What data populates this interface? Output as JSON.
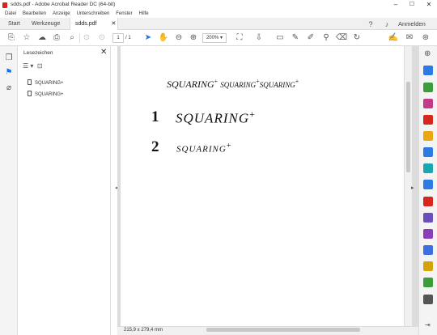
{
  "window": {
    "title": "sdds.pdf - Adobe Acrobat Reader DC (64-bit)",
    "controls": [
      "–",
      "☐",
      "✕"
    ]
  },
  "menu": [
    "Datei",
    "Bearbeiten",
    "Anzeige",
    "Unterschreiben",
    "Fenster",
    "Hilfe"
  ],
  "tabs": {
    "start": "Start",
    "tools": "Werkzeuge",
    "doc": "sdds.pdf",
    "signin": "Anmelden"
  },
  "toolbar": {
    "page_current": "1",
    "page_total": "/ 1",
    "zoom": "200%"
  },
  "bookmarks": {
    "header": "Lesezeichen",
    "items": [
      "SQUARING+",
      "SQUARING+"
    ]
  },
  "document": {
    "running": {
      "t1": "SQUARING",
      "t2": "SQUARING",
      "t3": "SQUARING",
      "sup": "+"
    },
    "sections": [
      {
        "num": "1",
        "title": "SQUARING",
        "sup": "+"
      },
      {
        "num": "2",
        "title": "SQUARING",
        "sup": "+"
      }
    ]
  },
  "status": {
    "page_size": "215,9 x 279,4 mm"
  },
  "icons": {
    "accent": "#1473e6",
    "right_rail_colors": [
      "#2c7be5",
      "#3b9e3a",
      "#c23a88",
      "#d9261c",
      "#e9a80f",
      "#2c7be5",
      "#1aa7b0",
      "#2c7be5",
      "#d9261c",
      "#6b4fbb",
      "#8a3fb8",
      "#3d6fe0",
      "#d4a20a",
      "#3b9e3a",
      "#555555"
    ]
  }
}
